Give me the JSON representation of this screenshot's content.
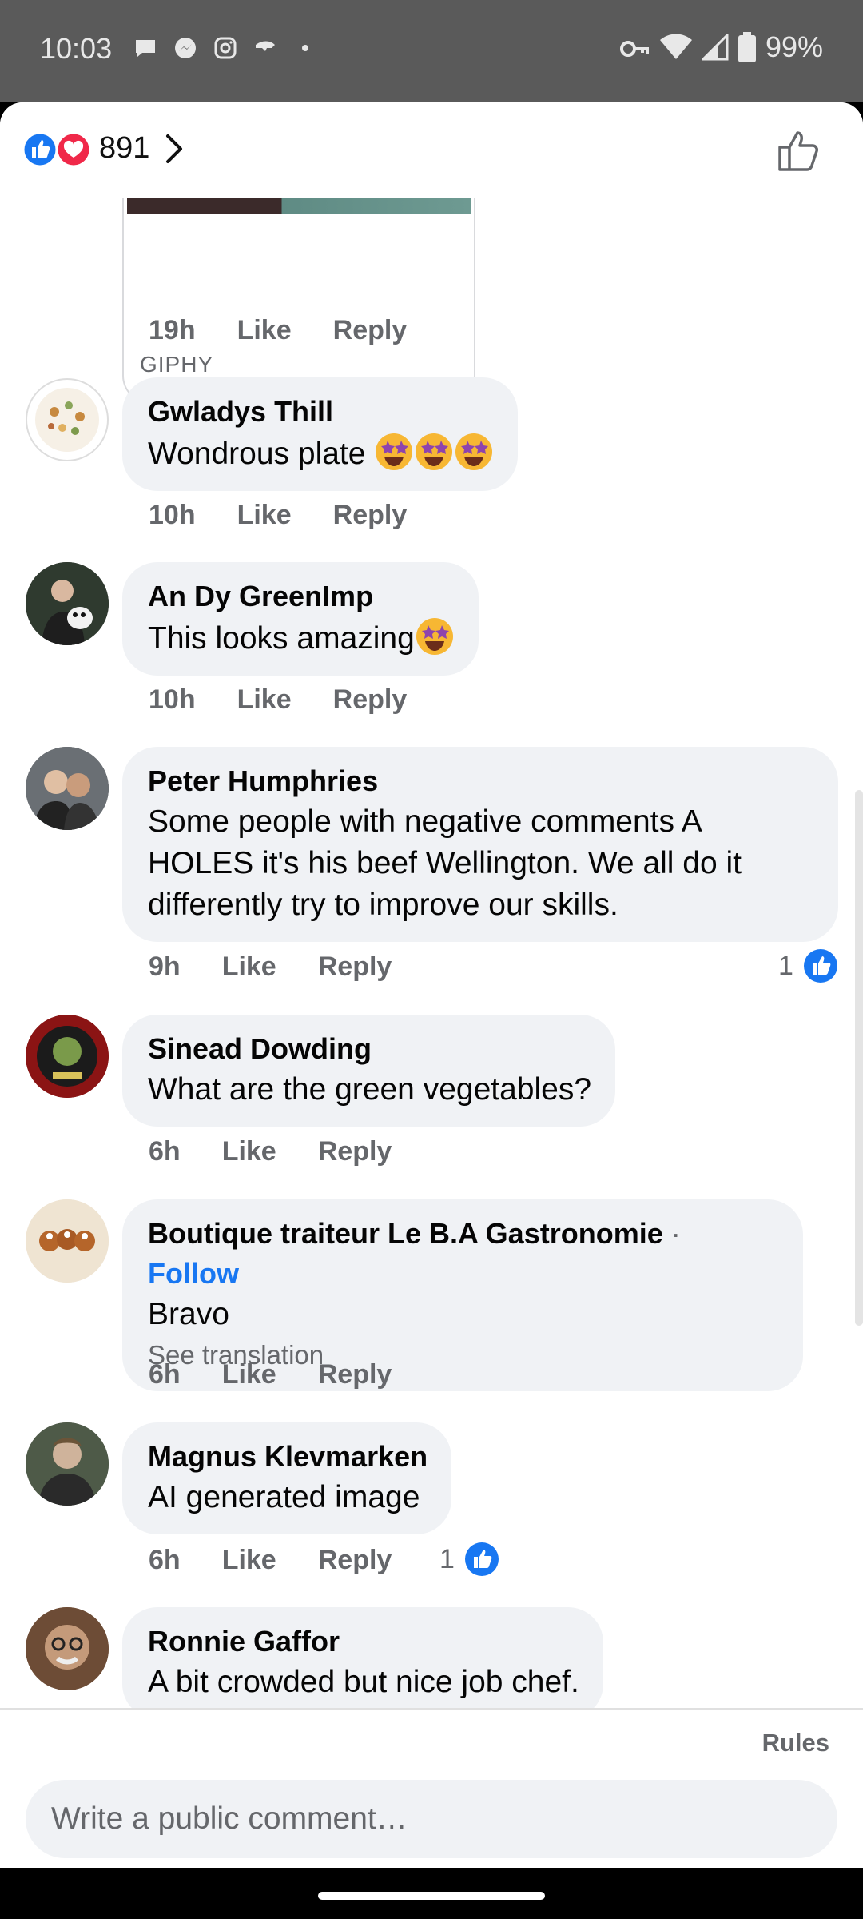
{
  "status_bar": {
    "time": "10:03",
    "battery": "99%"
  },
  "header": {
    "reaction_count": "891"
  },
  "giphy": {
    "label": "GIPHY",
    "time": "19h",
    "like": "Like",
    "reply": "Reply"
  },
  "comments": [
    {
      "name": "Gwladys Thill",
      "text": "Wondrous plate",
      "time": "10h",
      "like": "Like",
      "reply": "Reply"
    },
    {
      "name": "An Dy GreenImp",
      "text": "This looks amazing",
      "time": "10h",
      "like": "Like",
      "reply": "Reply"
    },
    {
      "name": "Peter Humphries",
      "text_lines": [
        "Some people with negative comments A",
        "HOLES it's his beef Wellington. We all do it",
        "differently try to improve our skills."
      ],
      "time": "9h",
      "like": "Like",
      "reply": "Reply",
      "likes": "1"
    },
    {
      "name": "Sinead Dowding",
      "text": "What are the green vegetables?",
      "time": "6h",
      "like": "Like",
      "reply": "Reply"
    },
    {
      "name": "Boutique traiteur Le B.A Gastronomie",
      "follow": "Follow",
      "separator": "·",
      "text": "Bravo",
      "see_translation": "See translation",
      "time": "6h",
      "like": "Like",
      "reply": "Reply"
    },
    {
      "name": "Magnus Klevmarken",
      "text": "AI generated image",
      "time": "6h",
      "like": "Like",
      "reply": "Reply",
      "likes": "1"
    },
    {
      "name": "Ronnie Gaffor",
      "text": "A bit crowded but nice job chef."
    }
  ],
  "footer": {
    "rules": "Rules",
    "composer_placeholder": "Write a public comment…"
  },
  "colors": {
    "accent": "#1877f2",
    "love": "#f02849",
    "bubble": "#f0f2f5",
    "muted": "#65676b"
  }
}
